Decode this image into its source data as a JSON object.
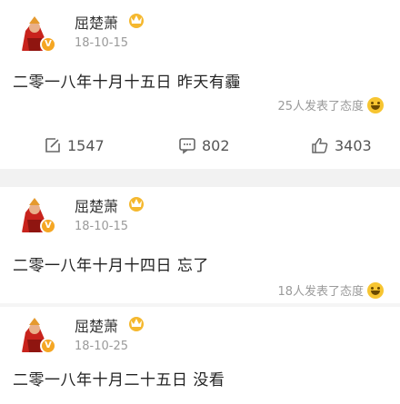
{
  "posts": [
    {
      "author": "屈楚萧",
      "date": "18-10-15",
      "content": "二零一八年十月十五日 昨天有霾",
      "reaction_text": "25人发表了态度",
      "actions": {
        "repost": "1547",
        "comment": "802",
        "like": "3403"
      }
    },
    {
      "author": "屈楚萧",
      "date": "18-10-15",
      "content": "二零一八年十月十四日 忘了",
      "reaction_text": "18人发表了态度"
    },
    {
      "author": "屈楚萧",
      "date": "18-10-25",
      "content": "二零一八年十月二十五日 没看"
    }
  ],
  "icons": {
    "avatar": "avatar-illustration-icon",
    "verified": "verified-badge-icon",
    "vip": "vip-crown-icon",
    "reaction": "smile-emoji-icon",
    "repost": "repost-icon",
    "comment": "comment-icon",
    "like": "thumbs-up-icon"
  },
  "colors": {
    "verified": "#f5a623",
    "divider": "#f2f2f2",
    "meta_text": "#9a9a9a"
  }
}
